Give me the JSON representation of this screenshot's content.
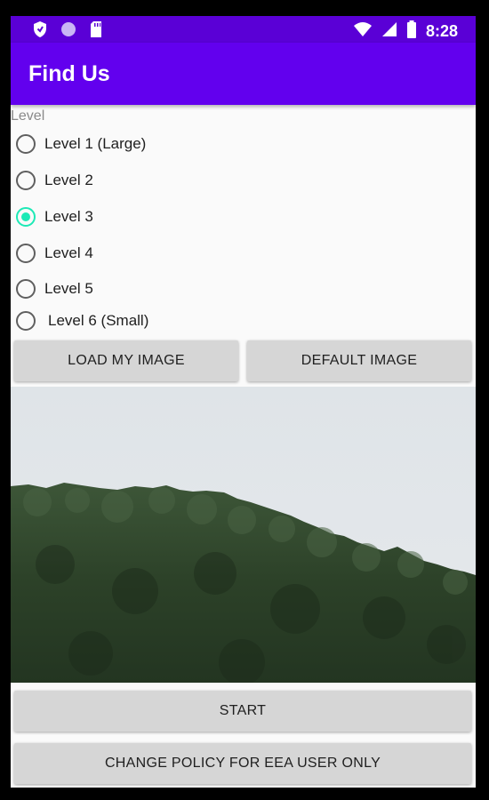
{
  "status_bar": {
    "time": "8:28",
    "left_icons": [
      "shield-icon",
      "circle-icon",
      "sd-card-icon"
    ],
    "right_icons": [
      "wifi-icon",
      "signal-icon",
      "battery-icon"
    ]
  },
  "app_bar": {
    "title": "Find Us"
  },
  "level_group": {
    "label": "Level",
    "options": [
      {
        "label": "Level 1 (Large)",
        "checked": false
      },
      {
        "label": "Level 2",
        "checked": false
      },
      {
        "label": "Level 3",
        "checked": true
      },
      {
        "label": "Level 4",
        "checked": false
      },
      {
        "label": "Level 5",
        "checked": false
      },
      {
        "label": "Level 6 (Small)",
        "checked": false
      }
    ]
  },
  "buttons": {
    "load_my_image": "LOAD MY IMAGE",
    "default_image": "DEFAULT IMAGE",
    "start": "START",
    "change_policy": "CHANGE POLICY FOR EEA USER ONLY"
  },
  "colors": {
    "primary": "#6200ee",
    "primary_dark": "#5a00d6",
    "accent": "#1de9b6"
  }
}
